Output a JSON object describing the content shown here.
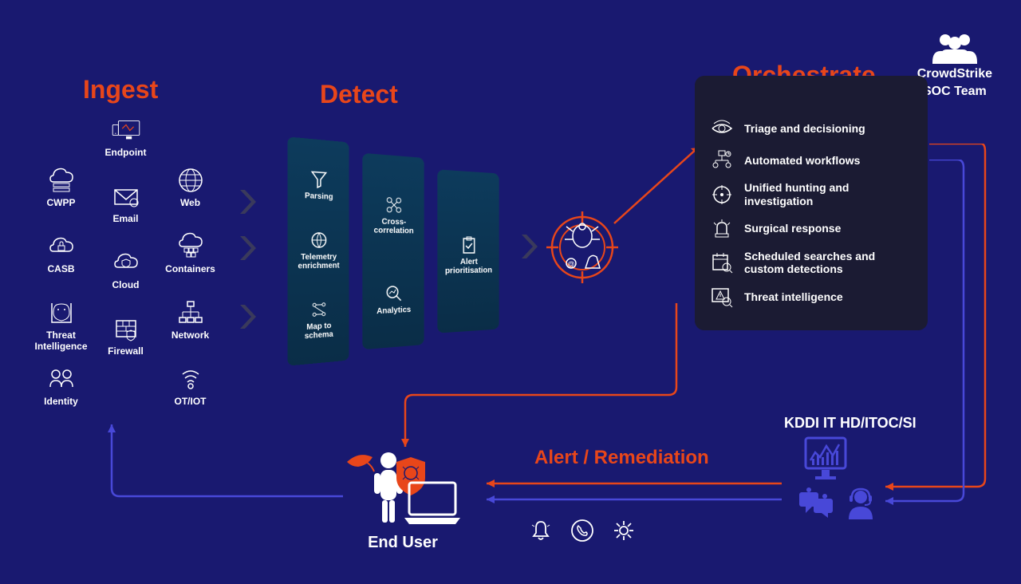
{
  "headings": {
    "ingest": "Ingest",
    "detect": "Detect",
    "orchestrate": "Orchestrate"
  },
  "soc": {
    "line1": "CrowdStrike",
    "line2": "SOC Team"
  },
  "ingest": {
    "endpoint": "Endpoint",
    "cwpp": "CWPP",
    "web": "Web",
    "email": "Email",
    "casb": "CASB",
    "containers": "Containers",
    "cloud": "Cloud",
    "threat_intel": "Threat Intelligence",
    "network": "Network",
    "firewall": "Firewall",
    "identity": "Identity",
    "otiot": "OT/IOT"
  },
  "detect": {
    "parsing": "Parsing",
    "telemetry": "Telemetry enrichment",
    "schema": "Map to schema",
    "cross": "Cross-correlation",
    "analytics": "Analytics",
    "alert": "Alert prioritisation"
  },
  "orchestrate": {
    "triage": "Triage and decisioning",
    "workflows": "Automated workflows",
    "hunting": "Unified hunting and investigation",
    "surgical": "Surgical response",
    "searches": "Scheduled searches and custom detections",
    "threat": "Threat intelligence"
  },
  "alert_remediation": "Alert / Remediation",
  "kddi": "KDDI  IT HD/ITOC/SI",
  "end_user": "End User"
}
